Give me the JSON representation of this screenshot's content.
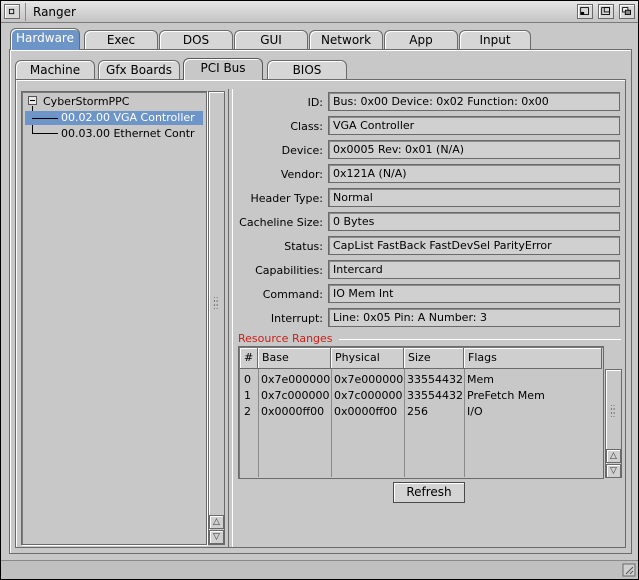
{
  "window": {
    "title": "Ranger"
  },
  "main_tabs": [
    "Hardware",
    "Exec",
    "DOS",
    "GUI",
    "Network",
    "App",
    "Input"
  ],
  "sub_tabs": [
    "Machine",
    "Gfx Boards",
    "PCI Bus",
    "BIOS"
  ],
  "tree": {
    "root": "CyberStormPPC",
    "children": [
      "00.02.00 VGA Controller",
      "00.03.00 Ethernet Contr"
    ]
  },
  "details": {
    "id_label": "ID:",
    "id_value": "Bus: 0x00 Device: 0x02 Function: 0x00",
    "class_label": "Class:",
    "class_value": "VGA Controller",
    "device_label": "Device:",
    "device_value": "0x0005 Rev: 0x01 (N/A)",
    "vendor_label": "Vendor:",
    "vendor_value": "0x121A (N/A)",
    "header_label": "Header Type:",
    "header_value": "Normal",
    "cacheline_label": "Cacheline Size:",
    "cacheline_value": "0 Bytes",
    "status_label": "Status:",
    "status_value": "CapList FastBack FastDevSel ParityError",
    "capabilities_label": "Capabilities:",
    "capabilities_value": "Intercard",
    "command_label": "Command:",
    "command_value": "IO Mem Int",
    "interrupt_label": "Interrupt:",
    "interrupt_value": "Line: 0x05 Pin: A Number: 3"
  },
  "resources": {
    "title": "Resource Ranges",
    "columns": [
      "#",
      "Base",
      "Physical",
      "Size",
      "Flags"
    ],
    "rows": [
      [
        "0",
        "0x7e000000",
        "0x7e000000",
        "33554432",
        "Mem"
      ],
      [
        "1",
        "0x7c000000",
        "0x7c000000",
        "33554432",
        "PreFetch Mem"
      ],
      [
        "2",
        "0x0000ff00",
        "0x0000ff00",
        "256",
        "I/O"
      ]
    ]
  },
  "refresh_label": "Refresh",
  "colors": {
    "accent": "#6e95c8",
    "group_title": "#c8201a",
    "background": "#c8c8c8"
  }
}
